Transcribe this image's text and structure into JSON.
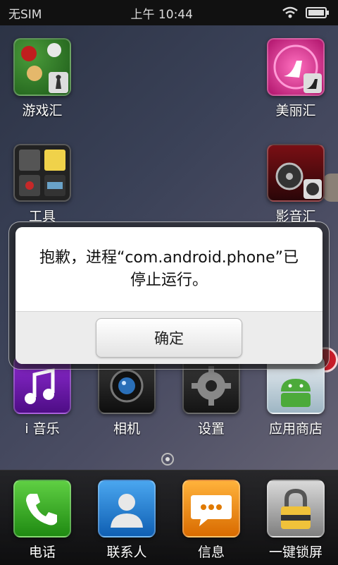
{
  "status_bar": {
    "carrier": "无SIM",
    "time": "上午 10:44"
  },
  "apps": [
    {
      "name": "游戏汇",
      "icon": "game-icon"
    },
    {
      "name": "美丽汇",
      "icon": "high-heel-icon"
    },
    {
      "name": "工具",
      "icon": "tools-icon"
    },
    {
      "name": "影音汇",
      "icon": "film-reel-icon"
    },
    {
      "name": "i 音乐",
      "icon": "music-note-icon"
    },
    {
      "name": "相机",
      "icon": "camera-icon"
    },
    {
      "name": "设置",
      "icon": "gear-icon"
    },
    {
      "name": "应用商店",
      "icon": "android-icon"
    }
  ],
  "dock": [
    {
      "name": "电话",
      "icon": "phone-icon"
    },
    {
      "name": "联系人",
      "icon": "contact-icon"
    },
    {
      "name": "信息",
      "icon": "message-icon"
    },
    {
      "name": "一键锁屏",
      "icon": "lock-icon"
    }
  ],
  "dialog": {
    "message_line1": "抱歉，进程“com.android.phone”已",
    "message_line2": "停止运行。",
    "ok_label": "确定"
  }
}
